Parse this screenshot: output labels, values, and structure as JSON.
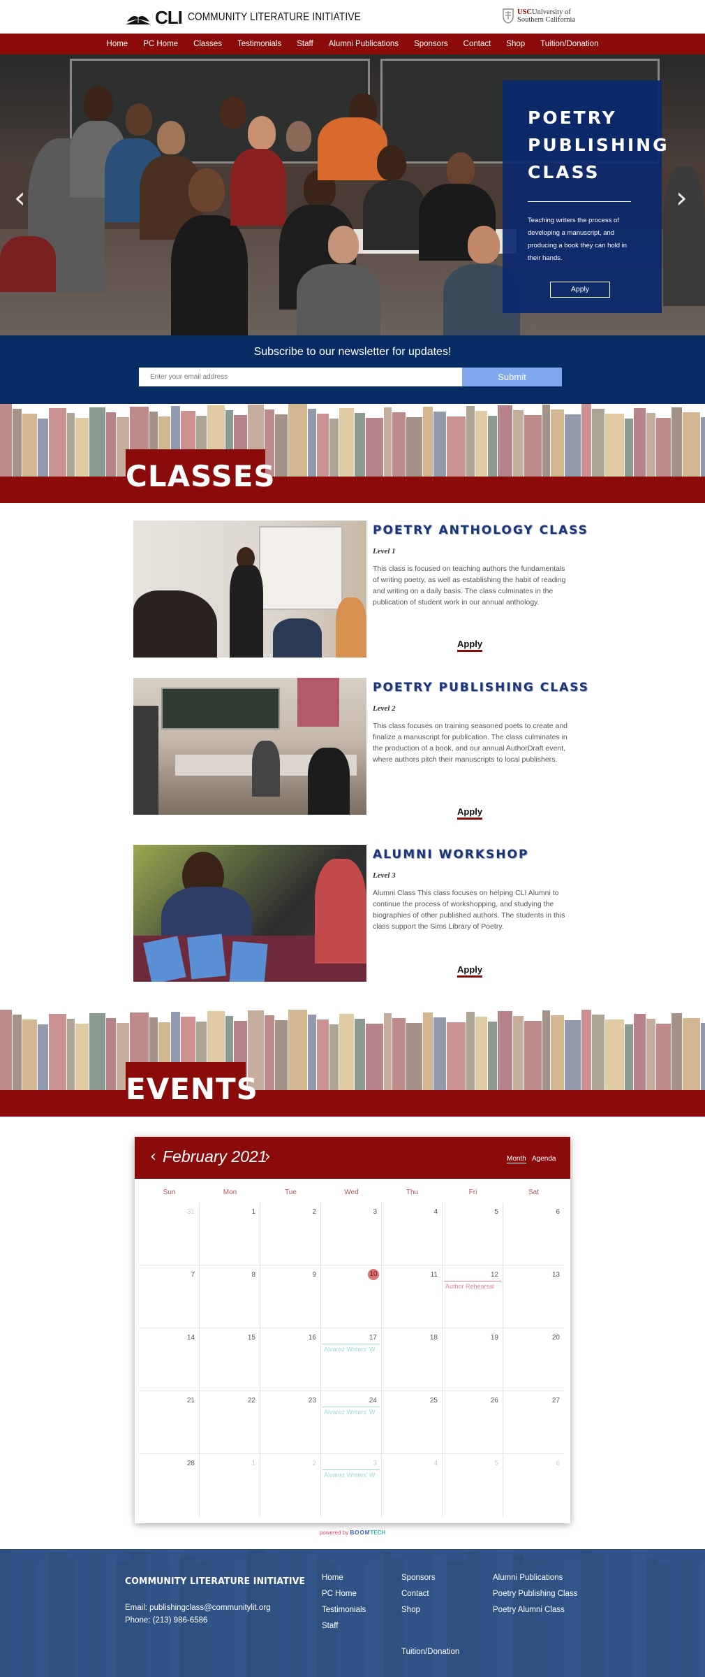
{
  "header": {
    "logo_mark": "CLI",
    "logo_name": "COMMUNITY LITERATURE INITIATIVE",
    "usc_brand": "USC",
    "usc_line1": "University of",
    "usc_line2": "Southern California"
  },
  "nav": [
    "Home",
    "PC Home",
    "Classes",
    "Testimonials",
    "Staff",
    "Alumni Publications",
    "Sponsors",
    "Contact",
    "Shop",
    "Tuition/Donation"
  ],
  "hero": {
    "title_lines": [
      "POETRY",
      "PUBLISHING",
      "CLASS"
    ],
    "description": "Teaching writers the process of developing a manuscript, and producing a book they can hold in their hands.",
    "button": "Apply",
    "prev_arrow": "‹",
    "next_arrow": "›"
  },
  "newsletter": {
    "title": "Subscribe to our newsletter for updates!",
    "placeholder": "Enter your email address",
    "submit": "Submit"
  },
  "classes_section": {
    "heading": "CLASSES"
  },
  "classes": [
    {
      "title": "POETRY ANTHOLOGY CLASS",
      "level": "Level 1",
      "description": "This class is focused on teaching authors the fundamentals of writing poetry, as well as establishing the habit of reading and writing on a daily basis. The class culminates in the publication of student work in our annual anthology.",
      "apply": "Apply"
    },
    {
      "title": "POETRY PUBLISHING CLASS",
      "level": "Level 2",
      "description": "This class focuses on training seasoned poets to create and finalize a manuscript for publication. The class culminates in the production of a book, and our annual AuthorDraft event, where authors pitch their manuscripts to local publishers.",
      "apply": "Apply"
    },
    {
      "title": "ALUMNI WORKSHOP",
      "level": "Level 3",
      "description": "Alumni Class This class focuses on helping CLI Alumni to continue the process of workshopping, and studying the biographies of other published authors.  The students in this class support the Sims Library of Poetry.",
      "apply": "Apply"
    }
  ],
  "events_section": {
    "heading": "EVENTS"
  },
  "calendar": {
    "month": "February 2021",
    "prev": "‹",
    "next": "›",
    "views": [
      "Month",
      "Agenda"
    ],
    "days_of_week": [
      "Sun",
      "Mon",
      "Tue",
      "Wed",
      "Thu",
      "Fri",
      "Sat"
    ],
    "weeks": [
      [
        {
          "d": "31",
          "m": true
        },
        {
          "d": "1"
        },
        {
          "d": "2"
        },
        {
          "d": "3"
        },
        {
          "d": "4"
        },
        {
          "d": "5"
        },
        {
          "d": "6"
        }
      ],
      [
        {
          "d": "7"
        },
        {
          "d": "8"
        },
        {
          "d": "9"
        },
        {
          "d": "10",
          "today": true
        },
        {
          "d": "11"
        },
        {
          "d": "12",
          "event": "Author Rehearsal",
          "color": "red"
        },
        {
          "d": "13"
        }
      ],
      [
        {
          "d": "14"
        },
        {
          "d": "15"
        },
        {
          "d": "16"
        },
        {
          "d": "17",
          "event": "Alvarez Writers' W",
          "color": "teal"
        },
        {
          "d": "18"
        },
        {
          "d": "19"
        },
        {
          "d": "20"
        }
      ],
      [
        {
          "d": "21"
        },
        {
          "d": "22"
        },
        {
          "d": "23"
        },
        {
          "d": "24",
          "event": "Alvarez Writers' W",
          "color": "teal"
        },
        {
          "d": "25"
        },
        {
          "d": "26"
        },
        {
          "d": "27"
        }
      ],
      [
        {
          "d": "28"
        },
        {
          "d": "1",
          "m": true
        },
        {
          "d": "2",
          "m": true
        },
        {
          "d": "3",
          "m": true,
          "event": "Alvarez Writers' W",
          "color": "teal"
        },
        {
          "d": "4",
          "m": true
        },
        {
          "d": "5",
          "m": true
        },
        {
          "d": "6",
          "m": true
        }
      ]
    ],
    "powered_prefix": "powered by",
    "powered_brand_a": "BOOM",
    "powered_brand_b": "TECH"
  },
  "footer": {
    "org": "COMMUNITY LITERATURE INITIATIVE",
    "email": "Email: publishingclass@communitylit.org",
    "phone": "Phone: (213) 986-6586",
    "col1": [
      "Home",
      "PC Home",
      "Testimonials",
      "Staff"
    ],
    "col2": [
      "Sponsors",
      "Contact",
      "Shop"
    ],
    "col2_extra": "Tuition/Donation",
    "col3": [
      "Alumni Publications",
      "Poetry Publishing Class",
      "Poetry Alumni Class"
    ]
  },
  "colors": {
    "brand_red": "#8b0a0a",
    "navy": "#062c63",
    "title_blue": "#1c3578",
    "submit_blue": "#7fa8ee",
    "footer_blue": "#173d78"
  }
}
